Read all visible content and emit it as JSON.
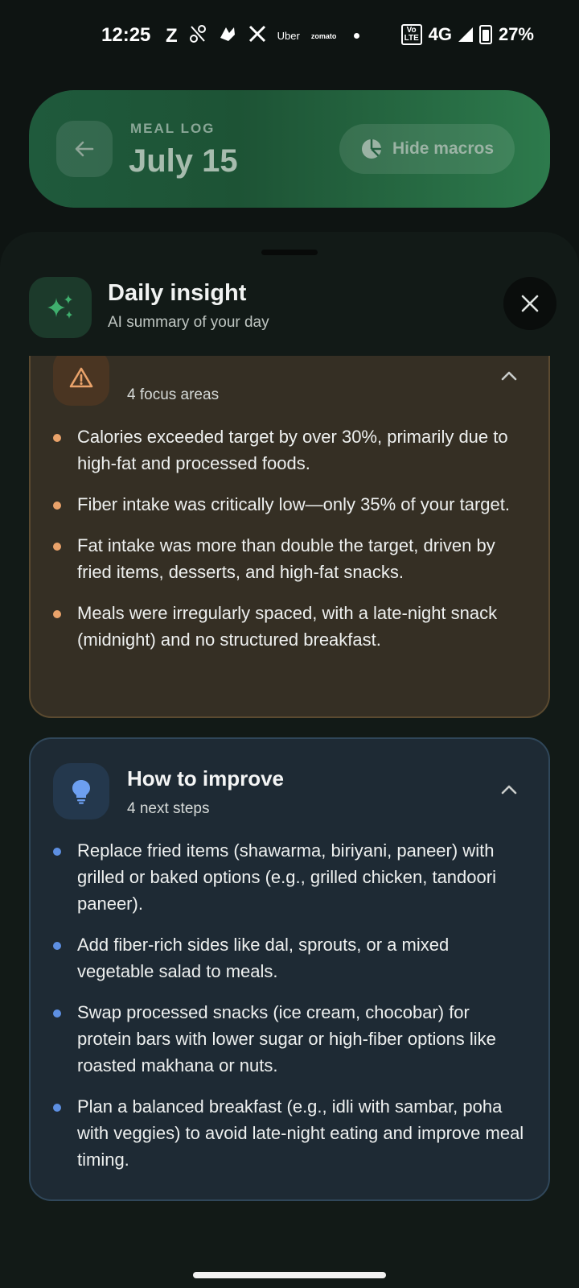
{
  "status_bar": {
    "time": "12:25",
    "apps": [
      "Z",
      "Uber",
      "zomato"
    ],
    "volte": "Vo LTE",
    "network": "4G",
    "battery": "27%"
  },
  "header": {
    "eyebrow": "MEAL LOG",
    "title": "July 15",
    "macro_button": "Hide macros"
  },
  "sheet": {
    "title": "Daily insight",
    "subtitle": "AI summary of your day"
  },
  "focus_card": {
    "count_label": "4 focus areas",
    "items": [
      "Calories exceeded target by over 30%, primarily due to high-fat and processed foods.",
      "Fiber intake was critically low—only 35% of your target.",
      "Fat intake was more than double the target, driven by fried items, desserts, and high-fat snacks.",
      "Meals were irregularly spaced, with a late-night snack (midnight) and no structured breakfast."
    ]
  },
  "improve_card": {
    "title": "How to improve",
    "count_label": "4 next steps",
    "items": [
      "Replace fried items (shawarma, biriyani, paneer) with grilled or baked options (e.g., grilled chicken, tandoori paneer).",
      "Add fiber-rich sides like dal, sprouts, or a mixed vegetable salad to meals.",
      "Swap processed snacks (ice cream, chocobar) for protein bars with lower sugar or high-fiber options like roasted makhana or nuts.",
      "Plan a balanced breakfast (e.g., idli with sambar, poha with veggies) to avoid late-night eating and improve meal timing."
    ]
  },
  "colors": {
    "header_green": "#1f5a3c",
    "focus_accent": "#e9a26a",
    "improve_accent": "#5d8fe2"
  }
}
